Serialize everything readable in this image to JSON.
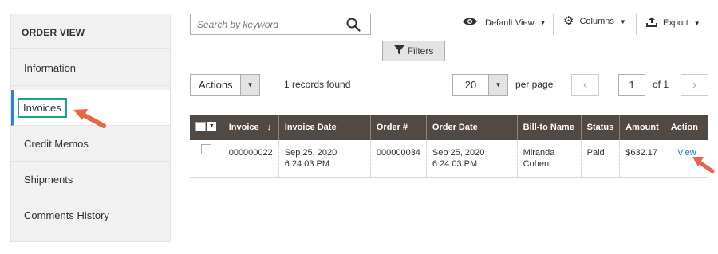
{
  "sidebar": {
    "title": "ORDER VIEW",
    "items": [
      {
        "label": "Information"
      },
      {
        "label": "Invoices"
      },
      {
        "label": "Credit Memos"
      },
      {
        "label": "Shipments"
      },
      {
        "label": "Comments History"
      }
    ]
  },
  "search": {
    "placeholder": "Search by keyword"
  },
  "toolbar": {
    "view_label": "Default View",
    "columns_label": "Columns",
    "export_label": "Export",
    "filters_label": "Filters"
  },
  "mass_actions": {
    "label": "Actions"
  },
  "records_found": "1 records found",
  "pagination": {
    "page_size": "20",
    "per_page_label": "per page",
    "current_page": "1",
    "of_label": "of 1"
  },
  "table": {
    "columns": [
      "Invoice",
      "Invoice Date",
      "Order #",
      "Order Date",
      "Bill-to Name",
      "Status",
      "Amount",
      "Action"
    ],
    "rows": [
      {
        "invoice": "000000022",
        "invoice_date": "Sep 25, 2020 6:24:03 PM",
        "order": "000000034",
        "order_date": "Sep 25, 2020 6:24:03 PM",
        "bill_to": "Miranda Cohen",
        "status": "Paid",
        "amount": "$632.17",
        "action": "View"
      }
    ]
  },
  "colors": {
    "header_bg": "#514943",
    "highlight": "#19a58b",
    "arrow": "#e8644a",
    "link": "#1979c3"
  }
}
